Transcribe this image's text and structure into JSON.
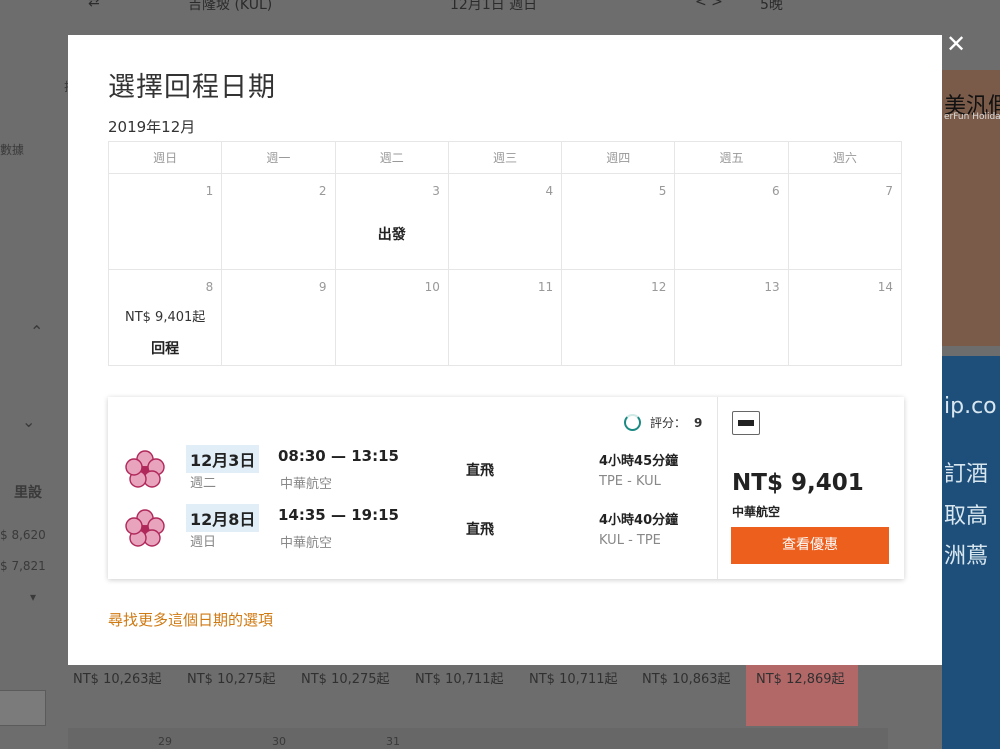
{
  "background": {
    "top_bar": [
      "⇄",
      "吉隆坡 (KUL)",
      "12月1日 週日",
      "< >",
      "5晚"
    ],
    "left_fragments": [
      "排",
      "數據",
      "里設",
      "$ 8,620",
      "$ 7,821"
    ],
    "right_ad_1": {
      "text": "美汎假期",
      "sub": "erFun Holiday"
    },
    "right_ad_2": [
      "ip.co",
      "訂酒",
      "取高",
      "洲蔦"
    ],
    "price_row": [
      "NT$ 10,263起",
      "NT$ 10,275起",
      "NT$ 10,275起",
      "NT$ 10,711起",
      "NT$ 10,711起",
      "NT$ 10,863起",
      "NT$ 12,869起"
    ],
    "bottom_row": [
      "29",
      "30",
      "31"
    ]
  },
  "modal": {
    "title": "選擇回程日期",
    "month": "2019年12月",
    "weekdays": [
      "週日",
      "週一",
      "週二",
      "週三",
      "週四",
      "週五",
      "週六"
    ],
    "weeks": [
      [
        {
          "day": "1"
        },
        {
          "day": "2"
        },
        {
          "day": "3",
          "label": "出發"
        },
        {
          "day": "4"
        },
        {
          "day": "5"
        },
        {
          "day": "6"
        },
        {
          "day": "7"
        }
      ],
      [
        {
          "day": "8",
          "price": "NT$ 9,401起",
          "label": "回程"
        },
        {
          "day": "9"
        },
        {
          "day": "10"
        },
        {
          "day": "11"
        },
        {
          "day": "12"
        },
        {
          "day": "13"
        },
        {
          "day": "14"
        }
      ]
    ],
    "result": {
      "score_label": "評分：",
      "score": "9",
      "legs": [
        {
          "date": "12月3日",
          "weekday": "週二",
          "times": "08:30 — 13:15",
          "carrier": "中華航空",
          "stops": "直飛",
          "duration": "4小時45分鐘",
          "route": "TPE - KUL"
        },
        {
          "date": "12月8日",
          "weekday": "週日",
          "times": "14:35 — 19:15",
          "carrier": "中華航空",
          "stops": "直飛",
          "duration": "4小時40分鐘",
          "route": "KUL - TPE"
        }
      ],
      "price": "NT$ 9,401",
      "price_carrier": "中華航空",
      "deal_button": "查看優惠"
    },
    "more_link": "尋找更多這個日期的選項"
  },
  "colors": {
    "accent": "#ec5f1d",
    "link": "#d07a13",
    "date_highlight": "#e1eef7",
    "score_ring": "#1a8a82"
  }
}
